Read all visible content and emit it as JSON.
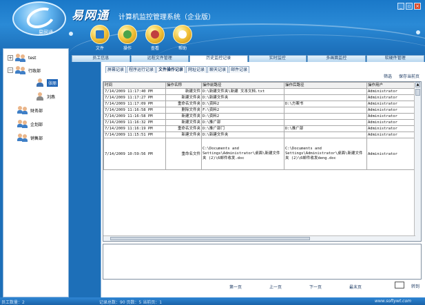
{
  "app": {
    "brand": "易网通",
    "logo_subtitle": "易网通",
    "title": "计算机监控管理系统（企业版）"
  },
  "window_buttons": [
    "_",
    "▫",
    "×"
  ],
  "toolbar": [
    {
      "label": "文件",
      "icon": "folder-icon"
    },
    {
      "label": "操作",
      "icon": "operation-icon"
    },
    {
      "label": "查看",
      "icon": "view-icon"
    },
    {
      "label": "帮助",
      "icon": "help-icon"
    }
  ],
  "module_tabs": [
    "员工信息",
    "远程文件管理",
    "历史监控记录",
    "实时监控",
    "多画面监控",
    "软硬件管理"
  ],
  "tree": {
    "root": "test",
    "groups": [
      {
        "label": "行政部"
      },
      {
        "label": "财务部"
      },
      {
        "label": "企划部"
      },
      {
        "label": "销售部"
      }
    ],
    "members": [
      {
        "label": "张丽"
      },
      {
        "label": "刘燕"
      }
    ]
  },
  "sub_tabs": [
    "屏幕记录",
    "程序运行记录",
    "文件操作记录",
    "网址记录",
    "聊天记录",
    "邮件记录"
  ],
  "links": {
    "filter": "筛选",
    "save": "保存当前页"
  },
  "table": {
    "headers": [
      "时间",
      "操作名称",
      "操作前路径",
      "操作后路径",
      "操作用户"
    ],
    "rows": [
      {
        "time": "7/14/2009 11:17:40 PM",
        "op": "新建文件",
        "before": "D:\\新建文件夹\\新建 文本文档.txt",
        "after": "",
        "user": "Administrator"
      },
      {
        "time": "7/14/2009 11:17:27 PM",
        "op": "新建文件夹",
        "before": "D:\\新建文件夹",
        "after": "",
        "user": "Administrator"
      },
      {
        "time": "7/14/2009 11:17:09 PM",
        "op": "重命名文件夹",
        "before": "D:\\资料2",
        "after": "D:\\方案书",
        "user": "Administrator"
      },
      {
        "time": "7/14/2009 11:16:58 PM",
        "op": "删除文件夹",
        "before": "F:\\资料2",
        "after": "",
        "user": "Administrator"
      },
      {
        "time": "7/14/2009 11:16:58 PM",
        "op": "新建文件夹",
        "before": "D:\\资料2",
        "after": "",
        "user": "Administrator"
      },
      {
        "time": "7/14/2009 11:16:32 PM",
        "op": "新建文件夹",
        "before": "D:\\推广部",
        "after": "",
        "user": "Administrator"
      },
      {
        "time": "7/14/2009 11:16:19 PM",
        "op": "重命名文件夹",
        "before": "D:\\推广部门",
        "after": "D:\\推广部",
        "user": "Administrator"
      },
      {
        "time": "7/14/2009 11:15:51 PM",
        "op": "新建文件夹",
        "before": "D:\\新建文件夹",
        "after": "",
        "user": "Administrator"
      },
      {
        "time": "7/14/2009 10:59:56 PM",
        "op": "重命名文件",
        "before": "C:\\Documents and Settings\\Administrator\\桌面\\新建文件夹 (2)\\6邮件收发.doc",
        "after": "C:\\Documents and Settings\\Administrator\\桌面\\新建文件夹 (2)\\6邮件收发deng.doc",
        "user": "Administrator"
      }
    ]
  },
  "pager": {
    "first": "第一页",
    "prev": "上一页",
    "next": "下一页",
    "last": "最末页",
    "goto": "转到"
  },
  "status": {
    "left": "员工数量：2",
    "middle": "记录总数：90  页数：5  当前页：1",
    "right": "www.softywt.com"
  }
}
